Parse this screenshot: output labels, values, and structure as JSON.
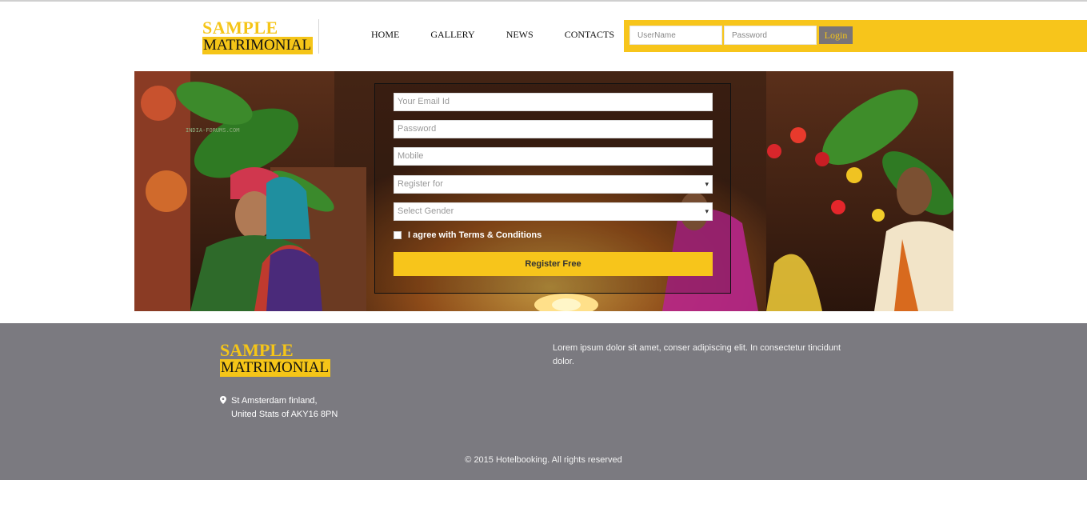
{
  "brand": {
    "line1": "SAMPLE",
    "line2": "MATRIMONIAL"
  },
  "nav": {
    "items": [
      "HOME",
      "GALLERY",
      "NEWS",
      "CONTACTS"
    ]
  },
  "login": {
    "username_placeholder": "UserName",
    "password_placeholder": "Password",
    "button": "Login"
  },
  "register_form": {
    "email_placeholder": "Your Email Id",
    "password_placeholder": "Password",
    "mobile_placeholder": "Mobile",
    "register_for_selected": "Register for",
    "gender_selected": "Select Gender",
    "terms_label": "I agree with Terms & Conditions",
    "submit_label": "Register Free"
  },
  "hero": {
    "watermark": "INDIA-FORUMS.COM"
  },
  "footer": {
    "brand": {
      "line1": "SAMPLE",
      "line2": "MATRIMONIAL"
    },
    "address_line1": "St Amsterdam finland,",
    "address_line2": "United Stats of AKY16 8PN",
    "description": "Lorem ipsum dolor sit amet, conser adipiscing elit. In consectetur tincidunt dolor.",
    "copyright": "© 2015 Hotelbooking. All rights reserved"
  },
  "colors": {
    "accent": "#f7c51b",
    "footer_bg": "#7b7a80",
    "login_button_bg": "#7a7476"
  },
  "icons": {
    "address": "map-pin-icon",
    "select": "caret-down-icon"
  }
}
